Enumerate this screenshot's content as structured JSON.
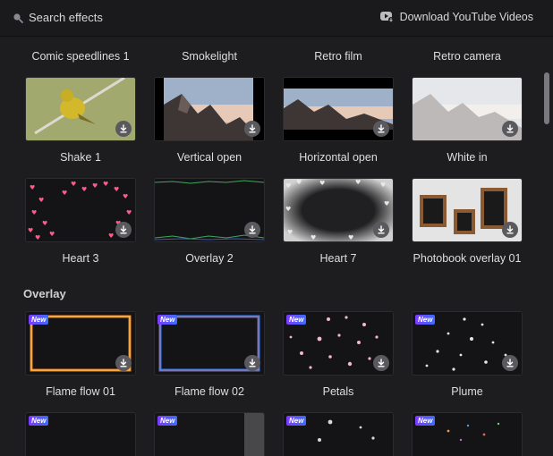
{
  "topbar": {
    "search_placeholder": "Search effects",
    "download_link": "Download YouTube Videos"
  },
  "rows": [
    {
      "labels": [
        "Comic speedlines 1",
        "Smokelight",
        "Retro film",
        "Retro camera"
      ]
    },
    {
      "labels": [
        "Shake 1",
        "Vertical open",
        "Horizontal open",
        "White in"
      ]
    },
    {
      "labels": [
        "Heart 3",
        "Overlay 2",
        "Heart 7",
        "Photobook overlay 01"
      ]
    }
  ],
  "overlay_section": {
    "title": "Overlay",
    "badge": "New",
    "items": [
      "Flame flow 01",
      "Flame flow 02",
      "Petals",
      "Plume"
    ]
  },
  "colors": {
    "background": "#1d1d1f",
    "badge_gradient_start": "#7c3cff",
    "badge_gradient_end": "#3c6cff",
    "heart": "#ff5a8a",
    "flame_orange": "#ff8a1c",
    "flame_blue": "#2a7dff"
  },
  "icons": {
    "search": "search-icon",
    "youtube": "youtube-download-icon",
    "download": "download-icon"
  }
}
